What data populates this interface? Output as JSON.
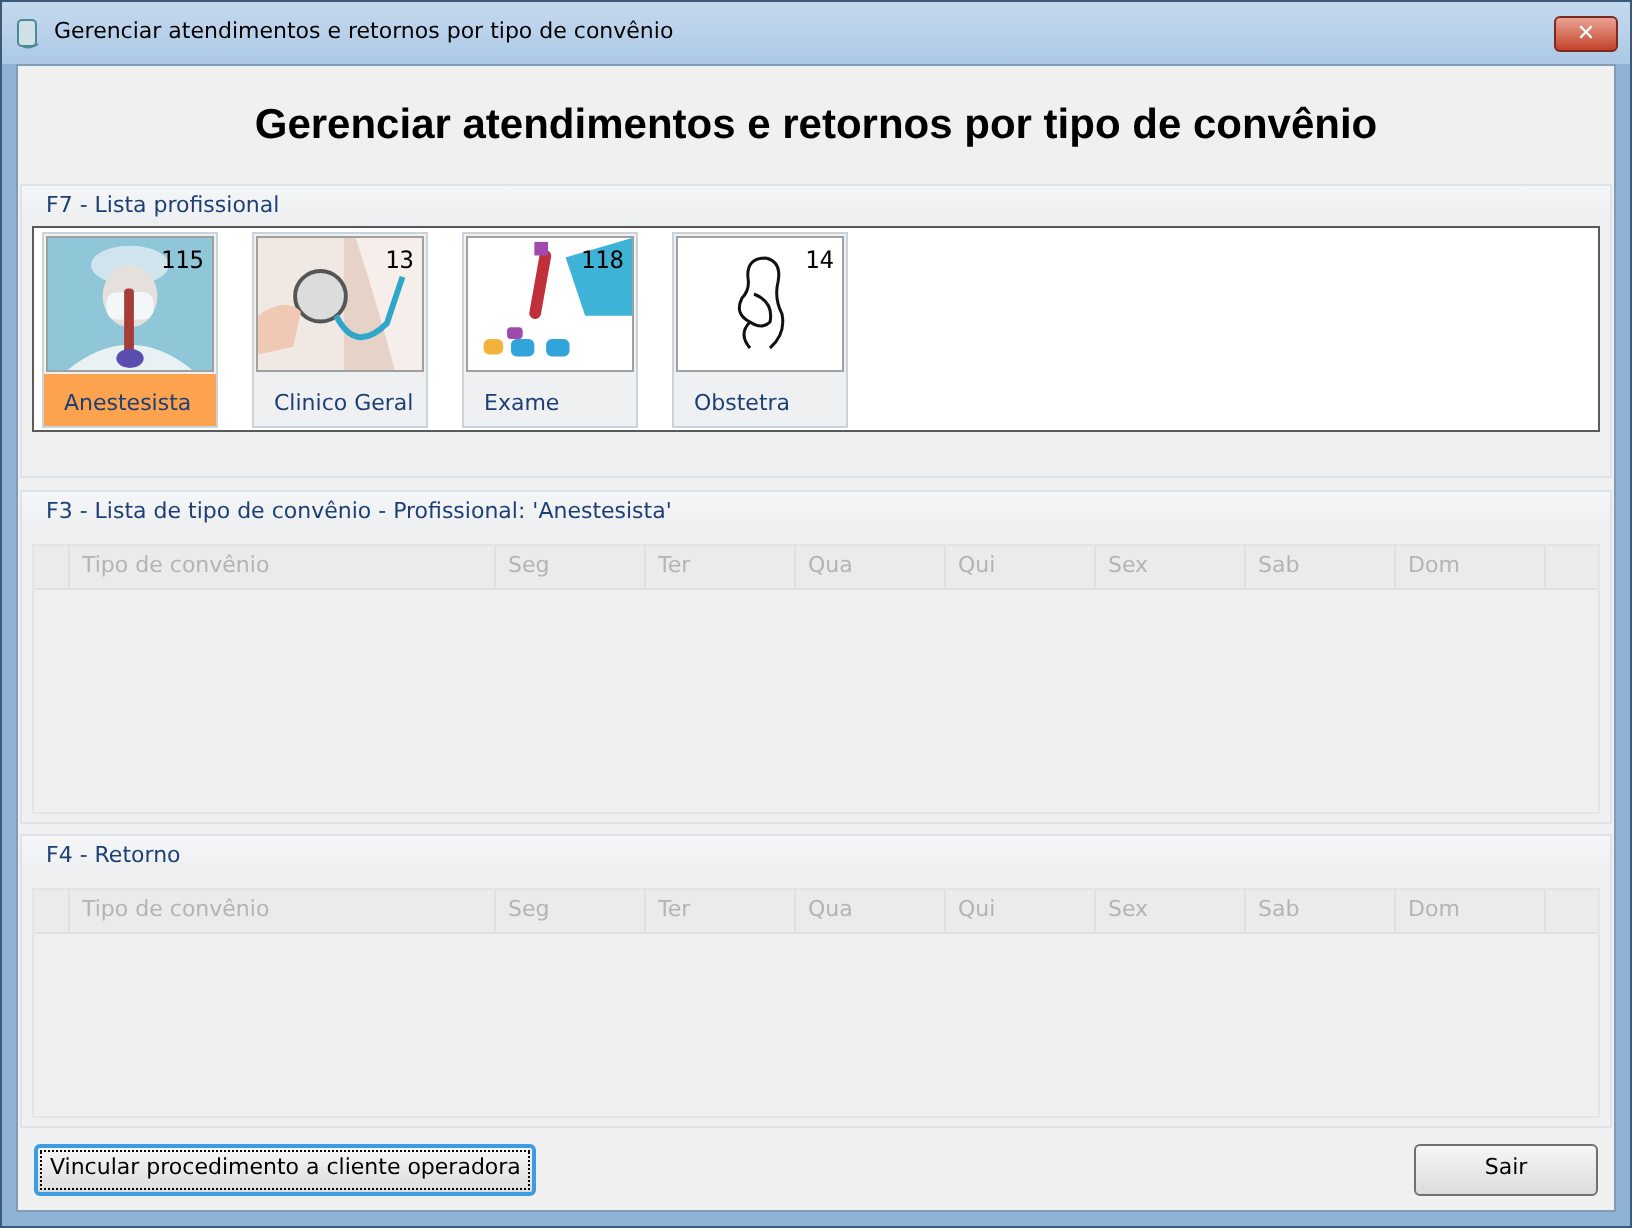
{
  "window": {
    "title": "Gerenciar atendimentos e retornos por tipo de convênio",
    "close": "✕"
  },
  "heading": "Gerenciar atendimentos e retornos por tipo de convênio",
  "professionals": {
    "title": "F7 - Lista profissional",
    "items": [
      {
        "label": "Anestesista",
        "count": "115",
        "selected": true
      },
      {
        "label": "Clinico Geral",
        "count": "13",
        "selected": false
      },
      {
        "label": "Exame",
        "count": "118",
        "selected": false
      },
      {
        "label": "Obstetra",
        "count": "14",
        "selected": false,
        "kind": "line-art"
      }
    ]
  },
  "agreements": {
    "title": "F3 - Lista de tipo de convênio - Profissional: 'Anestesista'",
    "columns": [
      "Tipo de convênio",
      "Seg",
      "Ter",
      "Qua",
      "Qui",
      "Sex",
      "Sab",
      "Dom"
    ]
  },
  "returns": {
    "title": "F4 - Retorno",
    "columns": [
      "Tipo de convênio",
      "Seg",
      "Ter",
      "Qua",
      "Qui",
      "Sex",
      "Sab",
      "Dom"
    ]
  },
  "buttons": [
    {
      "label": "Vincular procedimento a cliente operadora",
      "focused": true
    },
    {
      "label": "Sair",
      "focused": false
    }
  ]
}
